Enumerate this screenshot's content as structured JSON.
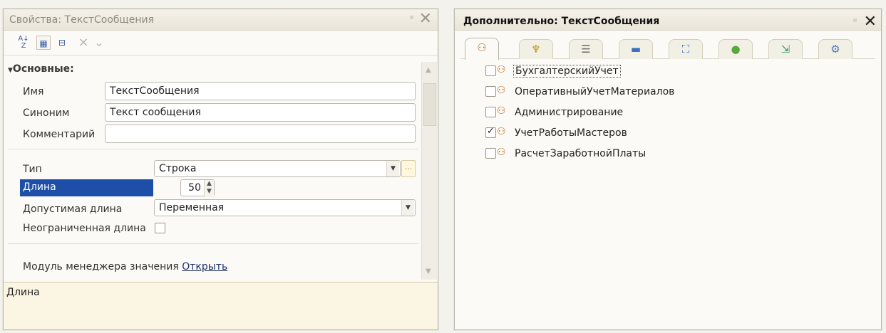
{
  "properties_panel": {
    "title": "Свойства: ТекстСообщения",
    "close_label": "✕",
    "toolbar": {
      "sort_icon": "sort-icon",
      "categories_icon": "categories-icon",
      "filter_icon": "filter-icon",
      "clear_icon": "×",
      "chevron_icon": "⌄"
    },
    "section_title": "Основные:",
    "fields": {
      "name": {
        "label": "Имя",
        "value": "ТекстСообщения"
      },
      "synonym": {
        "label": "Синоним",
        "value": "Текст сообщения"
      },
      "comment": {
        "label": "Комментарий",
        "value": ""
      },
      "type": {
        "label": "Тип",
        "value": "Строка",
        "more_label": "..."
      },
      "length": {
        "label": "Длина",
        "value": "50"
      },
      "allowed_length": {
        "label": "Допустимая длина",
        "value": "Переменная"
      },
      "unlimited_length": {
        "label": "Неограниченная длина",
        "checked": false
      },
      "value_manager_module": {
        "label": "Модуль менеджера значения",
        "link": "Открыть"
      }
    },
    "description": "Длина"
  },
  "extra_panel": {
    "title": "Дополнительно: ТекстСообщения",
    "close_label": "✕",
    "tabs": [
      {
        "name": "subsystems-tab",
        "icon": "subsystems-icon",
        "glyph": "⚇"
      },
      {
        "name": "roles-tab",
        "icon": "key-icon",
        "glyph": "♆"
      },
      {
        "name": "functional-options-tab",
        "icon": "list-icon",
        "glyph": "☰"
      },
      {
        "name": "minus-tab",
        "icon": "minus-icon",
        "glyph": "▬"
      },
      {
        "name": "structure-tab",
        "icon": "structure-icon",
        "glyph": "⛶"
      },
      {
        "name": "green-tab",
        "icon": "green-circle-icon",
        "glyph": "●"
      },
      {
        "name": "import-tab",
        "icon": "import-icon",
        "glyph": "⇲"
      },
      {
        "name": "settings-tab",
        "icon": "settings-icon",
        "glyph": "⚙"
      }
    ],
    "subsystems": [
      {
        "name": "БухгалтерскийУчет",
        "checked": false,
        "focused": true
      },
      {
        "name": "ОперативныйУчетМатериалов",
        "checked": false,
        "focused": false
      },
      {
        "name": "Администрирование",
        "checked": false,
        "focused": false
      },
      {
        "name": "УчетРаботыМастеров",
        "checked": true,
        "focused": false
      },
      {
        "name": "РасчетЗаработнойПлаты",
        "checked": false,
        "focused": false
      }
    ]
  },
  "colors": {
    "selection": "#1d4fa8",
    "description_bg": "#fbf6e3",
    "subsystem_icon": "#c4691a"
  }
}
